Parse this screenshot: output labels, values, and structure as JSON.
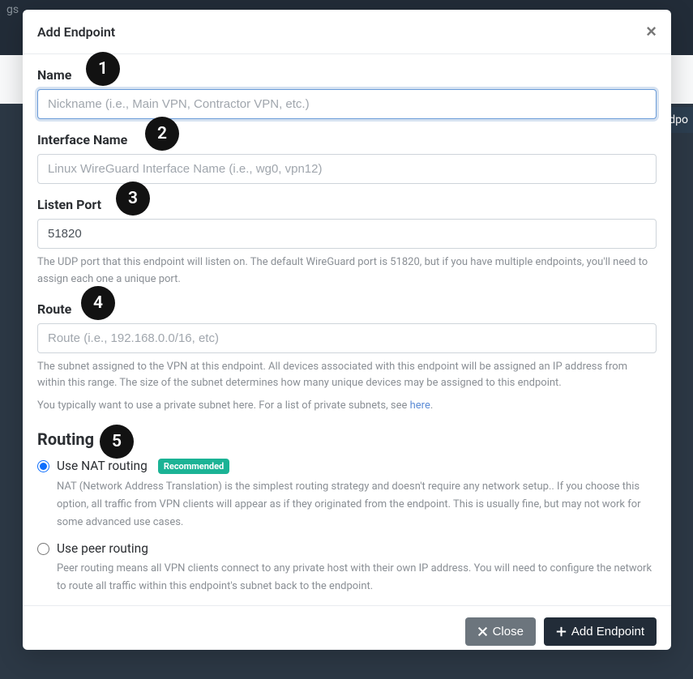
{
  "bg": {
    "nav_fragment": "gs",
    "rear_button_fragment": "dpo"
  },
  "modal": {
    "title": "Add Endpoint"
  },
  "fields": {
    "name": {
      "label": "Name",
      "placeholder": "Nickname (i.e., Main VPN, Contractor VPN, etc.)",
      "value": ""
    },
    "interface_name": {
      "label": "Interface Name",
      "placeholder": "Linux WireGuard Interface Name (i.e., wg0, vpn12)",
      "value": ""
    },
    "listen_port": {
      "label": "Listen Port",
      "value": "51820",
      "help": "The UDP port that this endpoint will listen on. The default WireGuard port is 51820, but if you have multiple endpoints, you'll need to assign each one a unique port."
    },
    "route": {
      "label": "Route",
      "placeholder": "Route (i.e., 192.168.0.0/16, etc)",
      "value": "",
      "help_1": "The subnet assigned to the VPN at this endpoint. All devices associated with this endpoint will be assigned an IP address from within this range. The size of the subnet determines how many unique devices may be assigned to this endpoint.",
      "help_2a": "You typically want to use a private subnet here. For a list of private subnets, see ",
      "help_2_link": "here",
      "help_2b": "."
    }
  },
  "routing": {
    "heading": "Routing",
    "nat": {
      "label": "Use NAT routing",
      "badge": "Recommended",
      "desc": "NAT (Network Address Translation) is the simplest routing strategy and doesn't require any network setup.. If you choose this option, all traffic from VPN clients will appear as if they originated from the endpoint. This is usually fine, but may not work for some advanced use cases."
    },
    "peer": {
      "label": "Use peer routing",
      "desc": "Peer routing means all VPN clients connect to any private host with their own IP address. You will need to configure the network to route all traffic within this endpoint's subnet back to the endpoint."
    }
  },
  "footer": {
    "close": "Close",
    "submit": "Add Endpoint"
  },
  "annotations": {
    "a1": "1",
    "a2": "2",
    "a3": "3",
    "a4": "4",
    "a5": "5"
  }
}
